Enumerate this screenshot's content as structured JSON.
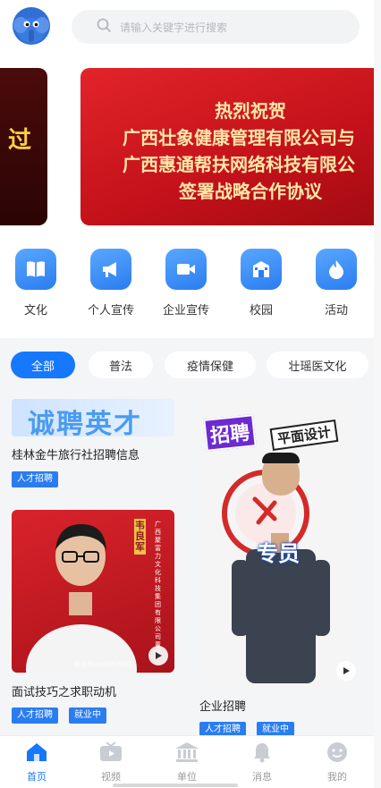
{
  "search": {
    "placeholder": "请输入关键字进行搜索"
  },
  "banner": {
    "prev_text": "过",
    "lines": [
      "热烈祝贺",
      "广西壮象健康管理有限公司与",
      "广西惠通帮扶网络科技有限公",
      "签署战略合作协议"
    ],
    "dot_count": 11,
    "active_dot_index": 2
  },
  "quick_menu": [
    {
      "label": "文化",
      "icon": "book-icon"
    },
    {
      "label": "个人宣传",
      "icon": "megaphone-icon"
    },
    {
      "label": "企业宣传",
      "icon": "video-camera-icon"
    },
    {
      "label": "校园",
      "icon": "school-building-icon"
    },
    {
      "label": "活动",
      "icon": "flame-icon"
    }
  ],
  "tabs": [
    {
      "label": "全部",
      "active": true
    },
    {
      "label": "普法",
      "active": false
    },
    {
      "label": "疫情保健",
      "active": false
    },
    {
      "label": "壮瑶医文化",
      "active": false
    }
  ],
  "feed": {
    "card1": {
      "banner_text": "诚聘英才",
      "title": "桂林金牛旅行社招聘信息",
      "tags": [
        "人才招聘"
      ]
    },
    "card2": {
      "name_tag": "韦良军",
      "side_text": "广西聚富力文化科技集团有限公司董事长",
      "watermark": "微信号wei1857781",
      "title": "面试技巧之求职动机",
      "tags": [
        "人才招聘",
        "就业中"
      ]
    },
    "card3": {
      "sticker1": "招聘",
      "sticker2": "平面设计",
      "overlay": "专员",
      "title": "企业招聘",
      "tags": [
        "人才招聘",
        "就业中"
      ]
    }
  },
  "nav": [
    {
      "label": "首页",
      "icon": "home-icon",
      "active": true
    },
    {
      "label": "视频",
      "icon": "tv-icon",
      "active": false
    },
    {
      "label": "单位",
      "icon": "institution-icon",
      "active": false
    },
    {
      "label": "消息",
      "icon": "bell-icon",
      "active": false
    },
    {
      "label": "我的",
      "icon": "user-face-icon",
      "active": false
    }
  ],
  "colors": {
    "primary": "#1677ff",
    "banner_red": "#c3111a",
    "tag_blue": "#2a7df0"
  }
}
